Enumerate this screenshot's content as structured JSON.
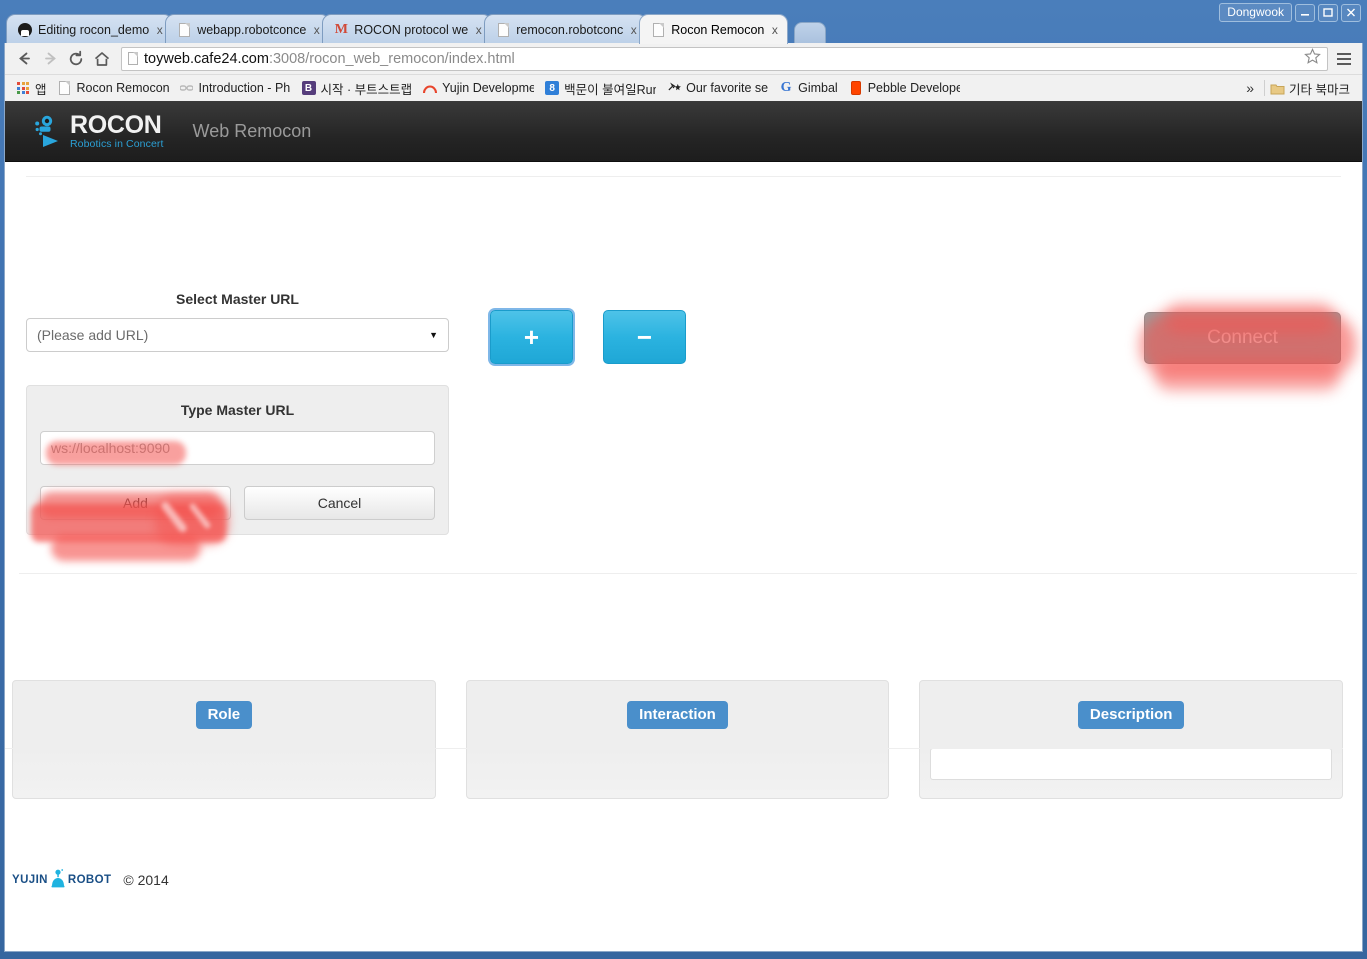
{
  "window": {
    "user_label": "Dongwook",
    "minimize_label": "Minimize",
    "maximize_label": "Maximize",
    "close_label": "Close"
  },
  "tabs": [
    {
      "title": "Editing rocon_demo",
      "favicon": "github-icon",
      "close_label": "x",
      "active": false
    },
    {
      "title": "webapp.robotconce",
      "favicon": "document-icon",
      "close_label": "x",
      "active": false
    },
    {
      "title": "ROCON protocol we",
      "favicon": "gmail-icon",
      "close_label": "x",
      "active": false
    },
    {
      "title": "remocon.robotconc",
      "favicon": "document-icon",
      "close_label": "x",
      "active": false
    },
    {
      "title": "Rocon Remocon",
      "favicon": "document-icon",
      "close_label": "x",
      "active": true
    }
  ],
  "toolbar": {
    "back_label": "Back",
    "forward_label": "Forward",
    "reload_label": "Reload",
    "home_label": "Home",
    "url_host": "toyweb.cafe24.com",
    "url_rest": ":3008/rocon_web_remocon/index.html",
    "url_full": "toyweb.cafe24.com:3008/rocon_web_remocon/index.html",
    "bookmark_star_label": "Bookmark this page",
    "menu_label": "Customize and control Chrome"
  },
  "bookmarks": {
    "apps_label": "앱",
    "items": [
      {
        "label": "Rocon Remocon",
        "icon": "document-icon"
      },
      {
        "label": "Introduction - Phi",
        "icon": "link-icon"
      },
      {
        "label": "시작 · 부트스트랩",
        "icon": "bootstrap-icon"
      },
      {
        "label": "Yujin Developme",
        "icon": "yujin-icon"
      },
      {
        "label": "백문이 불여일Run",
        "icon": "blogger-icon"
      },
      {
        "label": "Our favorite se",
        "icon": "star-icon"
      },
      {
        "label": "Gimbal",
        "icon": "google-icon"
      },
      {
        "label": "Pebble Develope",
        "icon": "pebble-icon"
      }
    ],
    "overflow_label": "»",
    "other_bookmarks_label": "기타 북마크",
    "other_bookmarks_icon": "folder-icon"
  },
  "navbar": {
    "brand_title": "ROCON",
    "brand_sub": "Robotics in Concert",
    "page_title": "Web Remocon",
    "brand_accent": "#2b9fd4"
  },
  "master_url": {
    "select_label": "Select Master URL",
    "select_value": "(Please add URL)",
    "select_options": [
      "(Please add URL)"
    ],
    "add_button_label": "+",
    "remove_button_label": "−",
    "connect_button_label": "Connect",
    "connect_disabled": true
  },
  "type_master_url": {
    "title": "Type Master URL",
    "input_value": "",
    "input_placeholder": "ws://localhost:9090",
    "add_label": "Add",
    "cancel_label": "Cancel"
  },
  "panels": [
    {
      "label": "Role",
      "has_input": false
    },
    {
      "label": "Interaction",
      "has_input": false
    },
    {
      "label": "Description",
      "has_input": true,
      "input_value": ""
    }
  ],
  "footer": {
    "logo_left": "YUJIN",
    "logo_right": "ROBOT",
    "copyright": "© 2014"
  },
  "colors": {
    "navbar_bg": "#222222",
    "primary_blue": "#2bb3e0",
    "badge_blue": "#4a8fcb",
    "highlight_red": "#f4534f",
    "disabled_gray": "#9d9d9d"
  }
}
